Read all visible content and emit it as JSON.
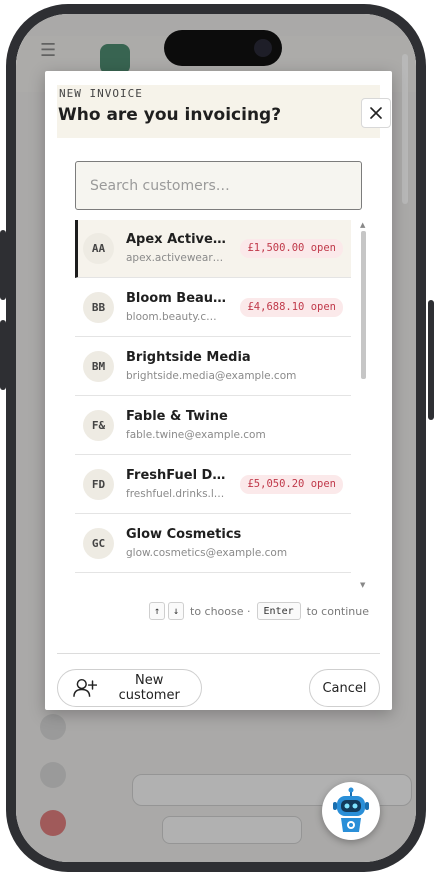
{
  "modal": {
    "eyebrow": "NEW INVOICE",
    "title": "Who are you invoicing?",
    "search_placeholder": "Search customers…",
    "customers": [
      {
        "initials": "AA",
        "name": "Apex Active…",
        "email": "apex.activewear…",
        "badge": "£1,500.00 open",
        "selected": true
      },
      {
        "initials": "BB",
        "name": "Bloom Beau…",
        "email": "bloom.beauty.c…",
        "badge": "£4,688.10 open"
      },
      {
        "initials": "BM",
        "name": "Brightside Media",
        "email": "brightside.media@example.com"
      },
      {
        "initials": "F&",
        "name": "Fable & Twine",
        "email": "fable.twine@example.com"
      },
      {
        "initials": "FD",
        "name": "FreshFuel Dr…",
        "email": "freshfuel.drinks.l…",
        "badge": "£5,050.20 open"
      },
      {
        "initials": "GC",
        "name": "Glow Cosmetics",
        "email": "glow.cosmetics@example.com"
      }
    ],
    "hint": {
      "key_up": "↑",
      "key_down": "↓",
      "choose_text": "to choose ·",
      "key_enter": "Enter",
      "continue_text": "to continue"
    },
    "new_customer_label": "New customer",
    "cancel_label": "Cancel"
  },
  "colors": {
    "badge_text": "#c0394a",
    "badge_bg": "#fbe9ea",
    "header_bg": "#f6f3ea",
    "selected_bg": "#f6f3ec"
  },
  "icons": {
    "close": "close-icon",
    "new_customer": "user-plus-icon",
    "assistant": "robot-icon"
  }
}
